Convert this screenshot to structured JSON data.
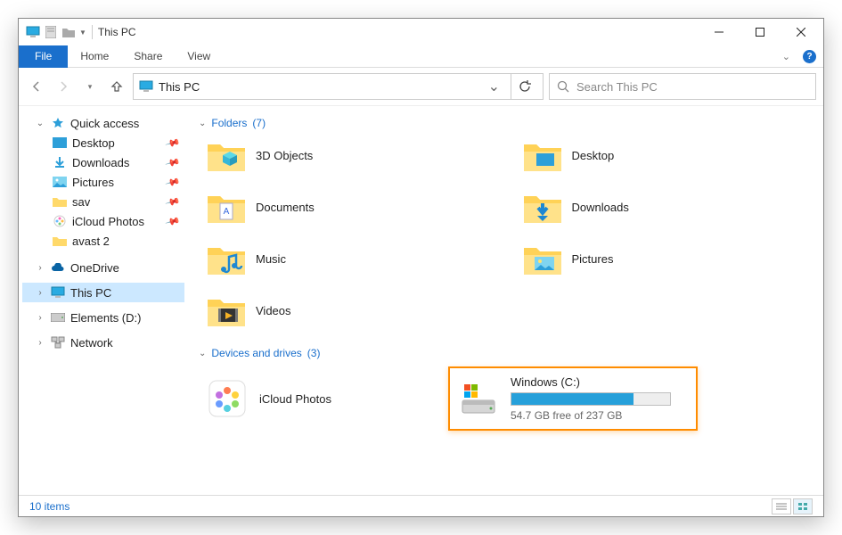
{
  "titlebar": {
    "title": "This PC"
  },
  "window_controls": {
    "min": "minimize",
    "max": "maximize",
    "close": "close"
  },
  "ribbon": {
    "file": "File",
    "tabs": [
      "Home",
      "Share",
      "View"
    ]
  },
  "navbar": {
    "breadcrumb": "This PC",
    "search_placeholder": "Search This PC"
  },
  "navpane": {
    "quick_access": {
      "label": "Quick access"
    },
    "qa_items": [
      {
        "label": "Desktop",
        "pinned": true
      },
      {
        "label": "Downloads",
        "pinned": true
      },
      {
        "label": "Pictures",
        "pinned": true
      },
      {
        "label": "sav",
        "pinned": true
      },
      {
        "label": "iCloud Photos",
        "pinned": true
      },
      {
        "label": "avast 2",
        "pinned": false
      }
    ],
    "onedrive": {
      "label": "OneDrive"
    },
    "thispc": {
      "label": "This PC"
    },
    "elements": {
      "label": "Elements (D:)"
    },
    "network": {
      "label": "Network"
    }
  },
  "content": {
    "folders_header": "Folders",
    "folders_count": "(7)",
    "folders": [
      {
        "label": "3D Objects"
      },
      {
        "label": "Desktop"
      },
      {
        "label": "Documents"
      },
      {
        "label": "Downloads"
      },
      {
        "label": "Music"
      },
      {
        "label": "Pictures"
      },
      {
        "label": "Videos"
      }
    ],
    "drives_header": "Devices and drives",
    "drives_count": "(3)",
    "drives": {
      "icloud": {
        "label": "iCloud Photos"
      },
      "windows": {
        "label": "Windows (C:)",
        "free_text": "54.7 GB free of 237 GB",
        "used_pct": 77
      }
    }
  },
  "statusbar": {
    "items": "10 items"
  }
}
